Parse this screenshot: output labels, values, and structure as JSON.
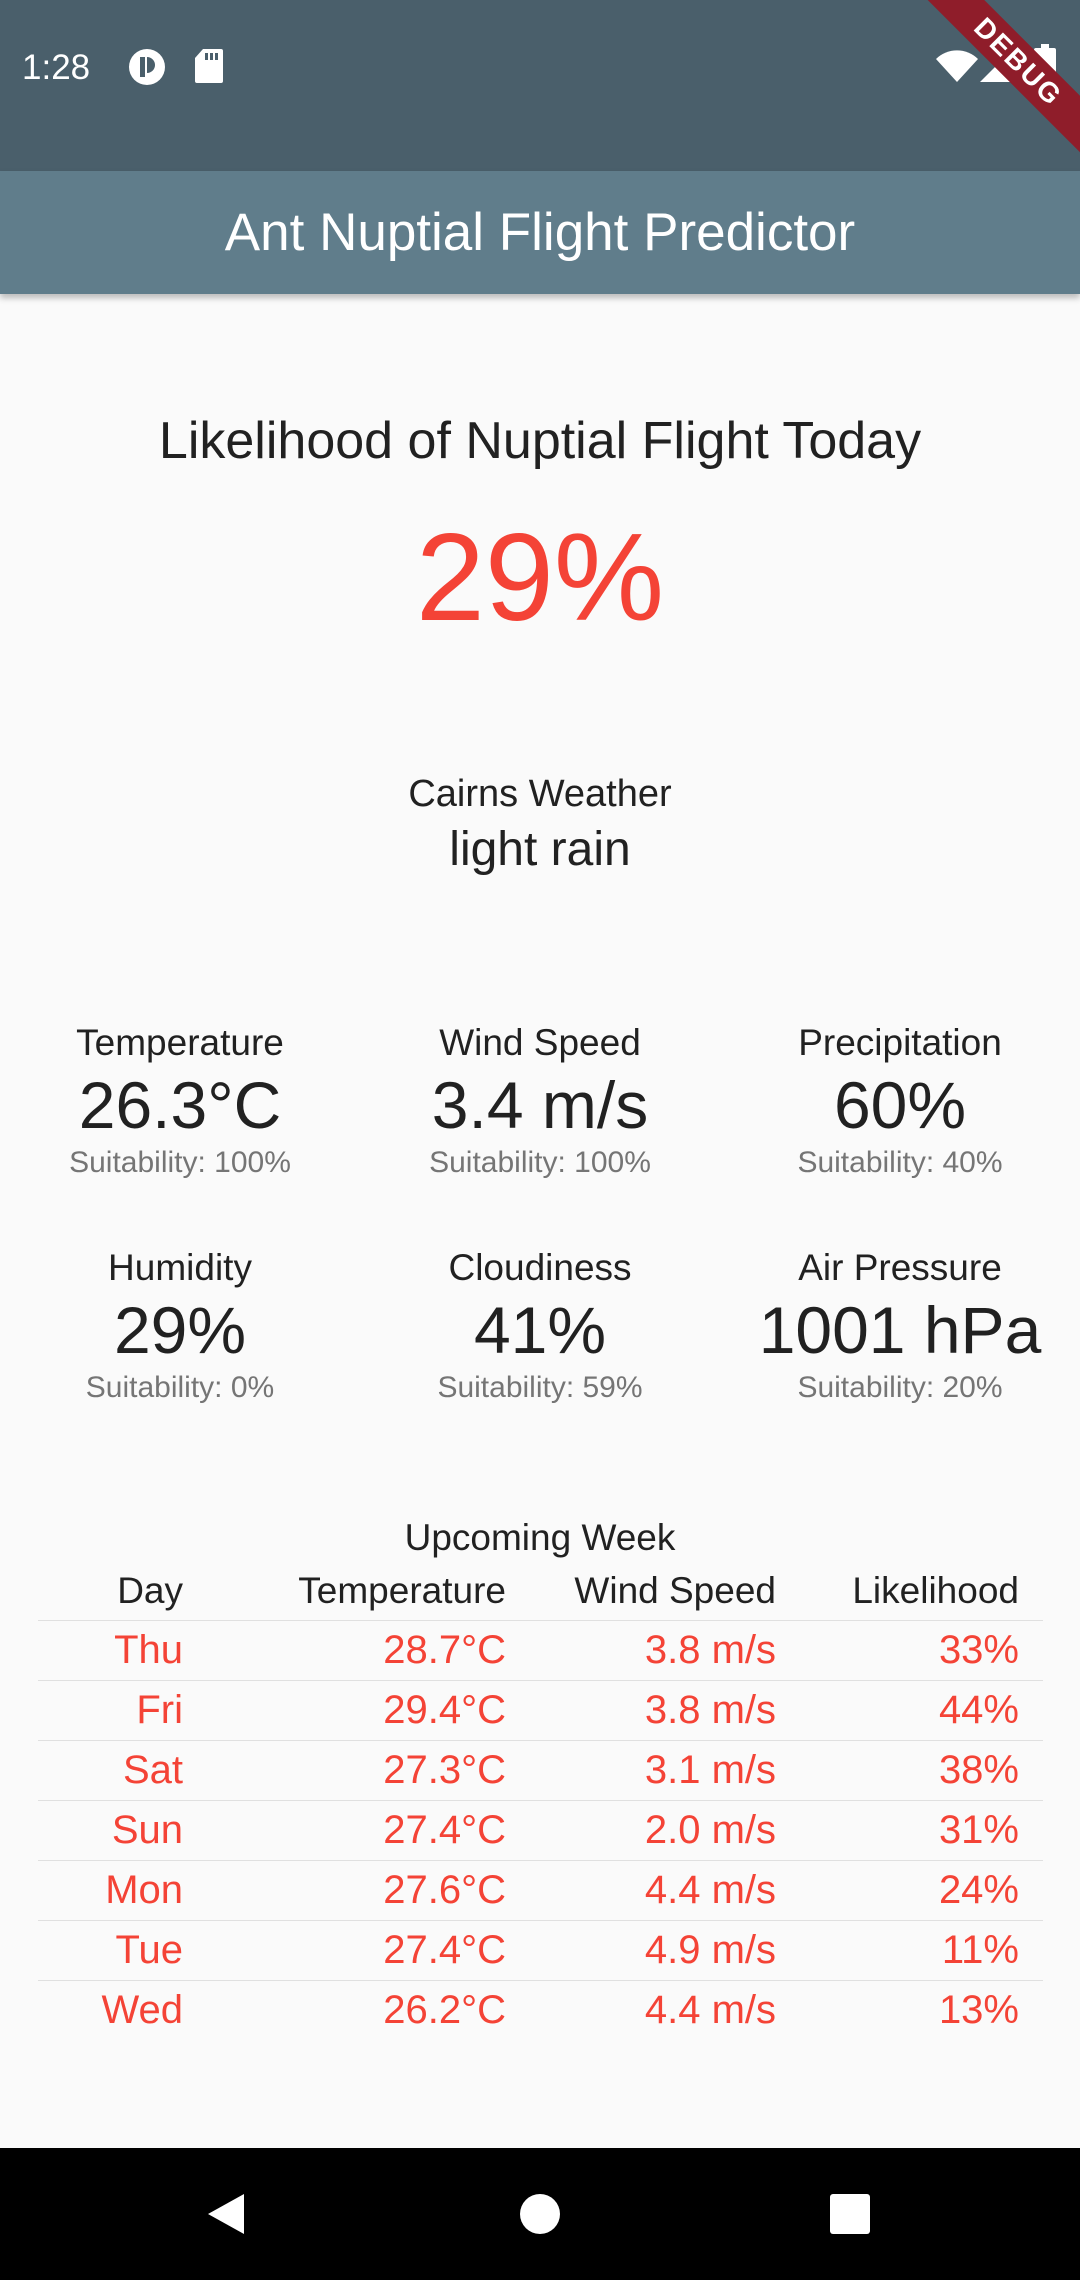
{
  "status_bar": {
    "time": "1:28",
    "debug_label": "DEBUG",
    "left_icons": [
      "app-notification-icon",
      "sd-card-icon"
    ],
    "right_icons": [
      "wifi-icon",
      "cell-signal-icon",
      "battery-icon"
    ]
  },
  "app_bar": {
    "title": "Ant Nuptial Flight Predictor"
  },
  "today": {
    "headline": "Likelihood of Nuptial Flight Today",
    "likelihood": "29%"
  },
  "weather": {
    "title": "Cairns Weather",
    "description": "light rain"
  },
  "metrics": [
    {
      "label": "Temperature",
      "value": "26.3°C",
      "suitability": "Suitability: 100%"
    },
    {
      "label": "Wind Speed",
      "value": "3.4 m/s",
      "suitability": "Suitability: 100%"
    },
    {
      "label": "Precipitation",
      "value": "60%",
      "suitability": "Suitability: 40%"
    },
    {
      "label": "Humidity",
      "value": "29%",
      "suitability": "Suitability: 0%"
    },
    {
      "label": "Cloudiness",
      "value": "41%",
      "suitability": "Suitability: 59%"
    },
    {
      "label": "Air Pressure",
      "value": "1001 hPa",
      "suitability": "Suitability: 20%"
    }
  ],
  "forecast": {
    "title": "Upcoming Week",
    "headers": [
      "Day",
      "Temperature",
      "Wind Speed",
      "Likelihood"
    ],
    "rows": [
      [
        "Thu",
        "28.7°C",
        "3.8 m/s",
        "33%"
      ],
      [
        "Fri",
        "29.4°C",
        "3.8 m/s",
        "44%"
      ],
      [
        "Sat",
        "27.3°C",
        "3.1 m/s",
        "38%"
      ],
      [
        "Sun",
        "27.4°C",
        "2.0 m/s",
        "31%"
      ],
      [
        "Mon",
        "27.6°C",
        "4.4 m/s",
        "24%"
      ],
      [
        "Tue",
        "27.4°C",
        "4.9 m/s",
        "11%"
      ],
      [
        "Wed",
        "26.2°C",
        "4.4 m/s",
        "13%"
      ]
    ]
  },
  "nav_bar": {
    "buttons": [
      "back-icon",
      "home-icon",
      "recents-icon"
    ]
  },
  "colors": {
    "status_bar": "#4a5f6b",
    "app_bar": "#607d8b",
    "accent_red": "#f44336",
    "background": "#fafafa",
    "debug_banner": "#8f1d2a"
  }
}
